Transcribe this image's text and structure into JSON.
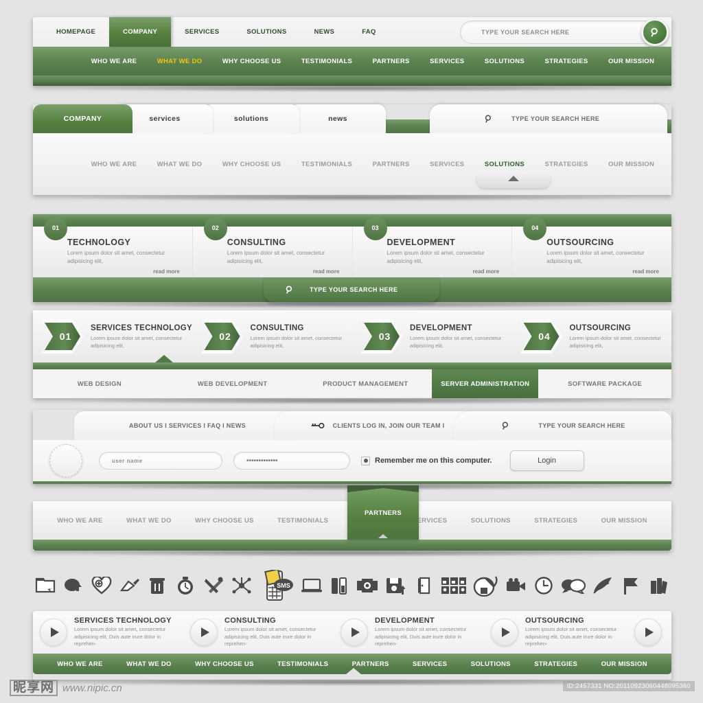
{
  "section1": {
    "main_nav": [
      {
        "label": "HOMEPAGE",
        "active": false
      },
      {
        "label": "COMPANY",
        "active": true
      },
      {
        "label": "SERVICES",
        "active": false
      },
      {
        "label": "SOLUTIONS",
        "active": false
      },
      {
        "label": "NEWS",
        "active": false
      },
      {
        "label": "FAQ",
        "active": false
      }
    ],
    "search_placeholder": "TYPE YOUR SEARCH HERE",
    "sub_nav": [
      {
        "label": "WHO WE ARE",
        "active": false
      },
      {
        "label": "WHAT WE DO",
        "active": true
      },
      {
        "label": "WHY CHOOSE US",
        "active": false
      },
      {
        "label": "TESTIMONIALS",
        "active": false
      },
      {
        "label": "PARTNERS",
        "active": false
      },
      {
        "label": "SERVICES",
        "active": false
      },
      {
        "label": "SOLUTIONS",
        "active": false
      },
      {
        "label": "STRATEGIES",
        "active": false
      },
      {
        "label": "OUR MISSION",
        "active": false
      }
    ]
  },
  "section2": {
    "tabs": [
      {
        "label": "COMPANY",
        "active": true
      },
      {
        "label": "services",
        "active": false
      },
      {
        "label": "solutions",
        "active": false
      },
      {
        "label": "news",
        "active": false
      }
    ],
    "search_placeholder": "TYPE YOUR SEARCH HERE",
    "links": [
      {
        "label": "WHO WE ARE",
        "active": false
      },
      {
        "label": "WHAT WE DO",
        "active": false
      },
      {
        "label": "WHY CHOOSE US",
        "active": false
      },
      {
        "label": "TESTIMONIALS",
        "active": false
      },
      {
        "label": "PARTNERS",
        "active": false
      },
      {
        "label": "SERVICES",
        "active": false
      },
      {
        "label": "SOLUTIONS",
        "active": true
      },
      {
        "label": "STRATEGIES",
        "active": false
      },
      {
        "label": "OUR MISSION",
        "active": false
      }
    ]
  },
  "section3": {
    "cards": [
      {
        "num": "01",
        "title": "TECHNOLOGY",
        "text": "Lorem ipsum dolor sit amet, consectetur adipisicing elit,",
        "link": "read more"
      },
      {
        "num": "02",
        "title": "CONSULTING",
        "text": "Lorem ipsum dolor sit amet, consectetur adipisicing elit,",
        "link": "read more"
      },
      {
        "num": "03",
        "title": "DEVELOPMENT",
        "text": "Lorem ipsum dolor sit amet, consectetur adipisicing elit,",
        "link": "read more"
      },
      {
        "num": "04",
        "title": "OUTSOURCING",
        "text": "Lorem ipsum dolor sit amet, consectetur adipisicing elit,",
        "link": "read more"
      }
    ],
    "search_placeholder": "TYPE YOUR SEARCH HERE"
  },
  "section4": {
    "items": [
      {
        "num": "01",
        "title": "SERVICES TECHNOLOGY",
        "text": "Lorem ipsum dolor sit amet, consectetur adipisicing elit,"
      },
      {
        "num": "02",
        "title": "CONSULTING",
        "text": "Lorem ipsum dolor sit amet, consectetur adipisicing elit,"
      },
      {
        "num": "03",
        "title": "DEVELOPMENT",
        "text": "Lorem ipsum dolor sit amet, consectetur adipisicing elit,"
      },
      {
        "num": "04",
        "title": "OUTSOURCING",
        "text": "Lorem ipsum dolor sit amet, consectetur adipisicing elit,"
      }
    ],
    "tabs": [
      {
        "label": "WEB DESIGN",
        "active": false
      },
      {
        "label": "WEB DEVELOPMENT",
        "active": false
      },
      {
        "label": "PRODUCT MANAGEMENT",
        "active": false
      },
      {
        "label": "SERVER ADMINISTRATION",
        "active": true
      },
      {
        "label": "SOFTWARE PACKAGE",
        "active": false
      }
    ]
  },
  "section5": {
    "links_label": "ABOUT US I SERVICES I FAQ I NEWS",
    "clients_label": "CLIENTS LOG IN, JOIN OUR TEAM I",
    "search_placeholder": "TYPE YOUR SEARCH HERE",
    "username_value": "user name",
    "password_value": "•••••••••••••",
    "remember_label": "Remember me on this computer.",
    "login_label": "Login"
  },
  "section6": {
    "items": [
      {
        "label": "WHO WE ARE",
        "active": false
      },
      {
        "label": "WHAT WE DO",
        "active": false
      },
      {
        "label": "WHY CHOOSE US",
        "active": false
      },
      {
        "label": "TESTIMONIALS",
        "active": false
      },
      {
        "label": "PARTNERS",
        "active": true
      },
      {
        "label": "SERVICES",
        "active": false
      },
      {
        "label": "SOLUTIONS",
        "active": false
      },
      {
        "label": "STRATEGIES",
        "active": false
      },
      {
        "label": "OUR MISSION",
        "active": false
      }
    ]
  },
  "section7": {
    "icons": [
      "folder-icon",
      "cloud-upload-icon",
      "heart-add-icon",
      "paint-brush-icon",
      "trash-icon",
      "stopwatch-icon",
      "tools-icon",
      "network-icon",
      "sms-phone-icon",
      "laptop-icon",
      "battery-icon",
      "film-strip-icon",
      "floppy-save-icon",
      "door-exit-icon",
      "contacts-grid-icon",
      "mouse-icon",
      "video-camera-icon",
      "clock-icon",
      "chat-bubbles-icon",
      "feather-pen-icon",
      "flag-icon",
      "books-icon"
    ]
  },
  "section8": {
    "cards": [
      {
        "title": "SERVICES TECHNOLOGY",
        "text": "Lorem ipsum dolor sit amet, consectetur adipisicing elit, Duis aute irure dolor in reprehen-"
      },
      {
        "title": "CONSULTING",
        "text": "Lorem ipsum dolor sit amet, consectetur adipisicing elit, Duis aute irure dolor in reprehen-"
      },
      {
        "title": "DEVELOPMENT",
        "text": "Lorem ipsum dolor sit amet, consectetur adipisicing elit, Duis aute irure dolor in reprehen-"
      },
      {
        "title": "OUTSOURCING",
        "text": "Lorem ipsum dolor sit amet, consectetur adipisicing elit, Duis aute irure dolor in reprehen-"
      }
    ],
    "nav": [
      {
        "label": "WHO WE ARE"
      },
      {
        "label": "WHAT WE DO"
      },
      {
        "label": "WHY CHOOSE US"
      },
      {
        "label": "TESTIMONIALS"
      },
      {
        "label": "PARTNERS"
      },
      {
        "label": "SERVICES"
      },
      {
        "label": "SOLUTIONS"
      },
      {
        "label": "STRATEGIES"
      },
      {
        "label": "OUR MISSION"
      }
    ]
  },
  "watermark": {
    "logo": "昵享网",
    "url": "www.nipic.cn",
    "id_tag": "ID:2457331 NO:20110923060448095360"
  },
  "colors": {
    "green": "#5b8250",
    "green_dark": "#3f5d38",
    "accent_yellow": "#f0c419",
    "page_bg": "#e4e4e4"
  }
}
